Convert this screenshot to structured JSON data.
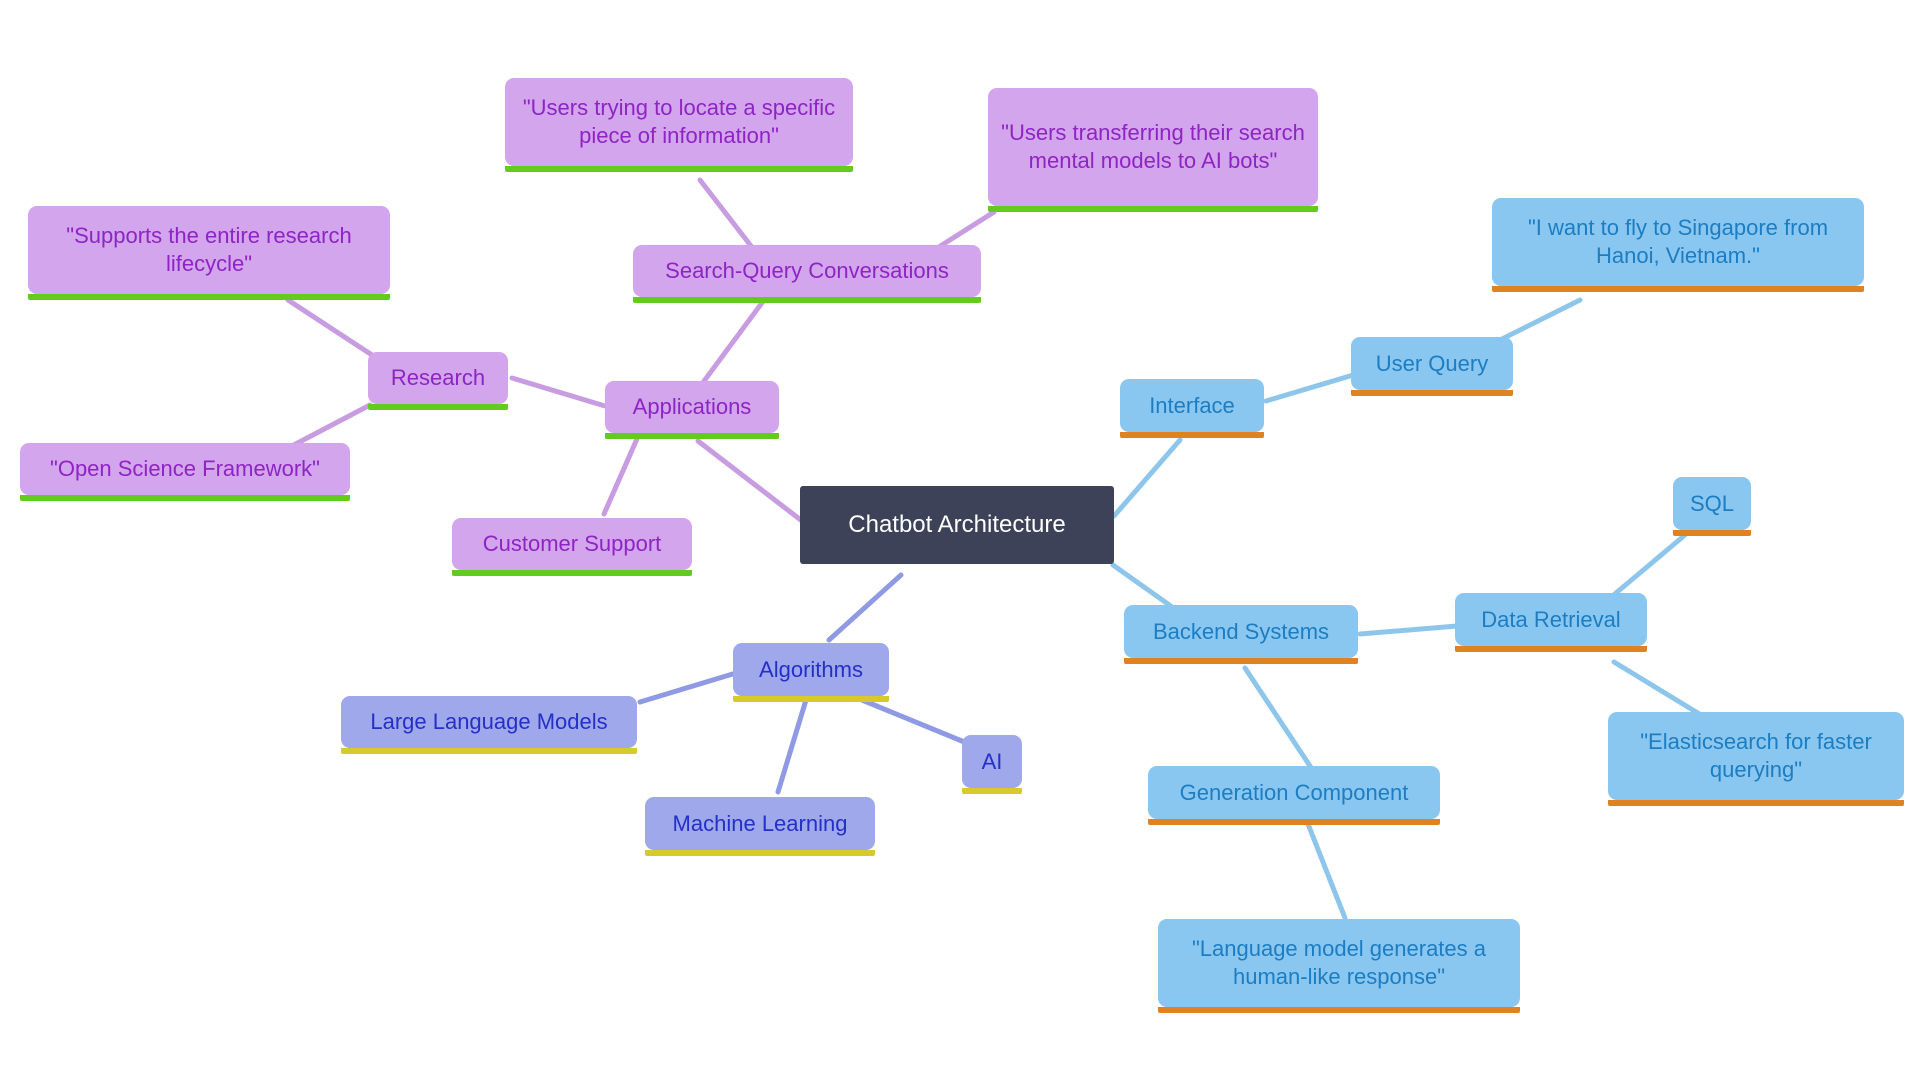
{
  "diagram": {
    "title": "Chatbot Architecture",
    "type": "mind-map",
    "background": "#ffffff",
    "branch_colors": {
      "applications": {
        "fill": "#d3a5ec",
        "text": "#8e24c4",
        "accent": "#63cb1e",
        "edge": "#c79ce0"
      },
      "algorithms": {
        "fill": "#a0a8ec",
        "text": "#2430c6",
        "accent": "#d6cb2a",
        "edge": "#8f99e4"
      },
      "interface_backend": {
        "fill": "#8ac7f0",
        "text": "#1c7dc2",
        "accent": "#e0821f",
        "edge": "#8dc6ea"
      },
      "root": {
        "fill": "#3e4259",
        "text": "#ffffff"
      }
    }
  },
  "nodes": {
    "root": {
      "label": "Chatbot Architecture"
    },
    "applications": {
      "label": "Applications"
    },
    "research": {
      "label": "Research"
    },
    "research_quote_lifecycle": {
      "label": "\"Supports the entire research lifecycle\""
    },
    "research_quote_osf": {
      "label": "\"Open Science Framework\""
    },
    "search_query_conversations": {
      "label": "Search-Query Conversations"
    },
    "sqc_quote_locate": {
      "label": "\"Users trying to locate a specific piece of information\""
    },
    "sqc_quote_mental_models": {
      "label": "\"Users transferring their search mental models to AI bots\""
    },
    "customer_support": {
      "label": "Customer Support"
    },
    "algorithms": {
      "label": "Algorithms"
    },
    "large_language_models": {
      "label": "Large Language Models"
    },
    "machine_learning": {
      "label": "Machine Learning"
    },
    "ai": {
      "label": "AI"
    },
    "interface": {
      "label": "Interface"
    },
    "user_query": {
      "label": "User Query"
    },
    "user_query_example": {
      "label": "\"I want to fly to Singapore from Hanoi, Vietnam.\""
    },
    "backend_systems": {
      "label": "Backend Systems"
    },
    "data_retrieval": {
      "label": "Data Retrieval"
    },
    "sql": {
      "label": "SQL"
    },
    "elasticsearch_quote": {
      "label": "\"Elasticsearch for faster querying\""
    },
    "generation_component": {
      "label": "Generation Component"
    },
    "generation_quote": {
      "label": "\"Language model generates a human-like response\""
    }
  },
  "edges": [
    {
      "from": "root",
      "to": "applications",
      "color": "#c79ce0"
    },
    {
      "from": "applications",
      "to": "research",
      "color": "#c79ce0"
    },
    {
      "from": "research",
      "to": "research_quote_lifecycle",
      "color": "#c79ce0"
    },
    {
      "from": "research",
      "to": "research_quote_osf",
      "color": "#c79ce0"
    },
    {
      "from": "applications",
      "to": "search_query_conversations",
      "color": "#c79ce0"
    },
    {
      "from": "search_query_conversations",
      "to": "sqc_quote_locate",
      "color": "#c79ce0"
    },
    {
      "from": "search_query_conversations",
      "to": "sqc_quote_mental_models",
      "color": "#c79ce0"
    },
    {
      "from": "applications",
      "to": "customer_support",
      "color": "#c79ce0"
    },
    {
      "from": "root",
      "to": "algorithms",
      "color": "#8f99e4"
    },
    {
      "from": "algorithms",
      "to": "large_language_models",
      "color": "#8f99e4"
    },
    {
      "from": "algorithms",
      "to": "machine_learning",
      "color": "#8f99e4"
    },
    {
      "from": "algorithms",
      "to": "ai",
      "color": "#8f99e4"
    },
    {
      "from": "root",
      "to": "interface",
      "color": "#8dc6ea"
    },
    {
      "from": "interface",
      "to": "user_query",
      "color": "#8dc6ea"
    },
    {
      "from": "user_query",
      "to": "user_query_example",
      "color": "#8dc6ea"
    },
    {
      "from": "root",
      "to": "backend_systems",
      "color": "#8dc6ea"
    },
    {
      "from": "backend_systems",
      "to": "data_retrieval",
      "color": "#8dc6ea"
    },
    {
      "from": "data_retrieval",
      "to": "sql",
      "color": "#8dc6ea"
    },
    {
      "from": "data_retrieval",
      "to": "elasticsearch_quote",
      "color": "#8dc6ea"
    },
    {
      "from": "backend_systems",
      "to": "generation_component",
      "color": "#8dc6ea"
    },
    {
      "from": "generation_component",
      "to": "generation_quote",
      "color": "#8dc6ea"
    }
  ]
}
